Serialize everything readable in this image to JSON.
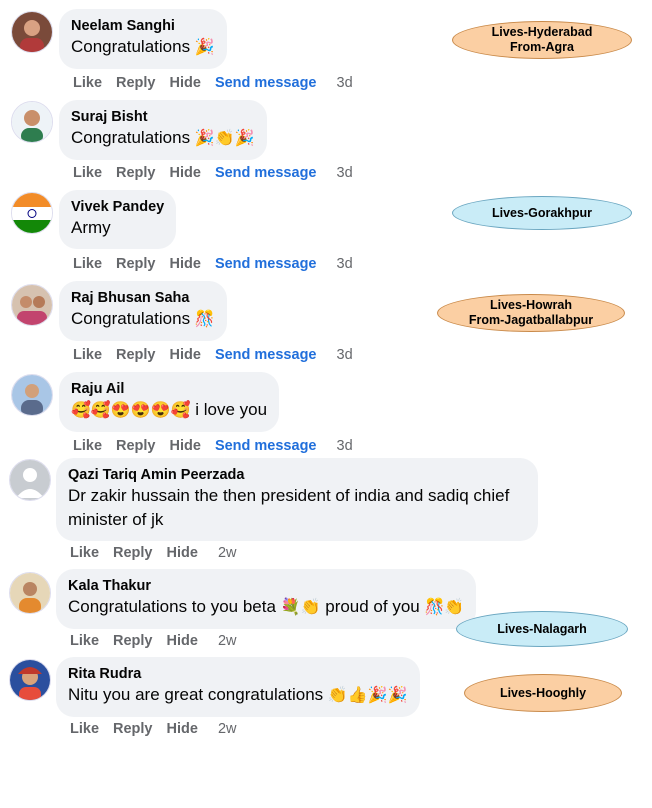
{
  "comments": [
    {
      "author": "Neelam Sanghi",
      "text": "Congratulations",
      "emoji": "🎉",
      "actions": {
        "like": "Like",
        "reply": "Reply",
        "hide": "Hide",
        "send": "Send message",
        "time": "3d"
      }
    },
    {
      "author": "Suraj Bisht",
      "text": "Congratulations",
      "emoji": "🎉👏🎉",
      "actions": {
        "like": "Like",
        "reply": "Reply",
        "hide": "Hide",
        "send": "Send message",
        "time": "3d"
      }
    },
    {
      "author": "Vivek Pandey",
      "text": "Army",
      "emoji": "",
      "actions": {
        "like": "Like",
        "reply": "Reply",
        "hide": "Hide",
        "send": "Send message",
        "time": "3d"
      }
    },
    {
      "author": "Raj Bhusan Saha",
      "text": "Congratulations",
      "emoji": "🎊",
      "actions": {
        "like": "Like",
        "reply": "Reply",
        "hide": "Hide",
        "send": "Send message",
        "time": "3d"
      }
    },
    {
      "author": "Raju Ail",
      "text": "i love you",
      "emoji": "🥰🥰😍😍😍🥰",
      "actions": {
        "like": "Like",
        "reply": "Reply",
        "hide": "Hide",
        "send": "Send message",
        "time": "3d"
      }
    },
    {
      "author": "Qazi Tariq Amin Peerzada",
      "text": "Dr zakir hussain the then president of india and sadiq chief minister of jk",
      "emoji": "",
      "actions": {
        "like": "Like",
        "reply": "Reply",
        "hide": "Hide",
        "time": "2w"
      }
    },
    {
      "author": "Kala Thakur",
      "text": "Congratulations to you beta",
      "emoji": "💐👏",
      "text2": "proud of you",
      "emoji2": "🎊👏",
      "actions": {
        "like": "Like",
        "reply": "Reply",
        "hide": "Hide",
        "time": "2w"
      }
    },
    {
      "author": "Rita Rudra",
      "text": "Nitu you are great congratulations",
      "emoji": "👏👍🎉🎉",
      "actions": {
        "like": "Like",
        "reply": "Reply",
        "hide": "Hide",
        "time": "2w"
      }
    }
  ],
  "annotations": [
    {
      "text": "Lives-Hyderabad\nFrom-Agra",
      "color": "#fbcfa3"
    },
    {
      "text": "Lives-Gorakhpur",
      "color": "#c9ecf7"
    },
    {
      "text": "Lives-Howrah\nFrom-Jagatballabpur",
      "color": "#fbcfa3"
    },
    {
      "text": "Lives-Nalagarh",
      "color": "#c9ecf7"
    },
    {
      "text": "Lives-Hooghly",
      "color": "#fbcfa3"
    }
  ]
}
